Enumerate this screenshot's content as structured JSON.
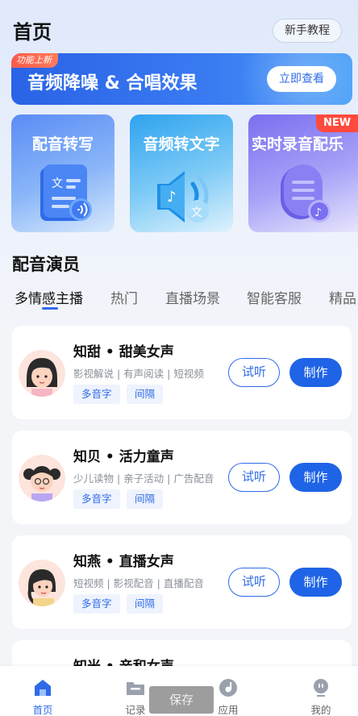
{
  "header": {
    "title": "首页",
    "tutorial_button": "新手教程"
  },
  "banner": {
    "badge": "功能上新",
    "title": "音频降噪 & 合唱效果",
    "button": "立即查看"
  },
  "features": [
    {
      "label": "配音转写"
    },
    {
      "label": "音频转文字"
    },
    {
      "label": "实时录音配乐",
      "badge": "NEW"
    }
  ],
  "section": {
    "title": "配音演员"
  },
  "tabs": [
    "多情感主播",
    "热门",
    "直播场景",
    "智能客服",
    "精品"
  ],
  "voices": [
    {
      "name": "知甜 • 甜美女声",
      "desc": "影视解说 | 有声阅读 | 短视频",
      "tags": [
        "多音字",
        "间隔"
      ],
      "listen": "试听",
      "make": "制作"
    },
    {
      "name": "知贝 • 活力童声",
      "desc": "少儿读物 | 亲子活动 | 广告配音",
      "tags": [
        "多音字",
        "间隔"
      ],
      "listen": "试听",
      "make": "制作"
    },
    {
      "name": "知燕 • 直播女声",
      "desc": "短视频 | 影视配音 | 直播配音",
      "tags": [
        "多音字",
        "间隔"
      ],
      "listen": "试听",
      "make": "制作"
    },
    {
      "name": "知米 • 亲和女声"
    }
  ],
  "toast": "保存",
  "nav": [
    {
      "label": "首页"
    },
    {
      "label": "记录"
    },
    {
      "label": "应用"
    },
    {
      "label": "我的"
    }
  ],
  "colors": {
    "accent": "#2f6be8",
    "badge_red": "#ff4a3d"
  }
}
